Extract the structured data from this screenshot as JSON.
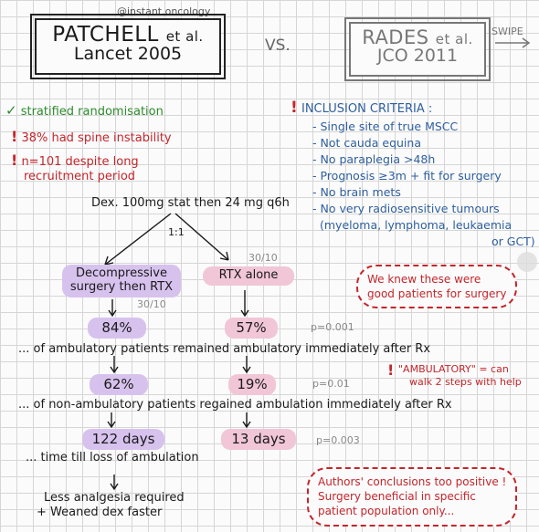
{
  "handle": "@instant.oncology",
  "swipe": "SWIPE",
  "vs": "VS.",
  "left_study": {
    "name": "PATCHELL",
    "etal": "et al.",
    "journal": "Lancet 2005"
  },
  "right_study": {
    "name": "RADES",
    "etal": "et al.",
    "journal": "JCO 2011"
  },
  "left_notes": [
    {
      "mark": "✓",
      "text": "stratified randomisation"
    },
    {
      "mark": "!",
      "text": "38% had spine instability"
    },
    {
      "mark": "!",
      "text": "n=101 despite long",
      "text2": "recruitment period"
    }
  ],
  "inclusion": {
    "mark": "!",
    "heading": "INCLUSION CRITERIA :",
    "items": [
      "- Single site of true MSCC",
      "- Not cauda equina",
      "- No paraplegia >48h",
      "- Prognosis ≥3m + fit for surgery",
      "- No brain mets",
      "- No very radiosensitive tumours",
      "(myeloma, lymphoma, leukaemia",
      "or GCT)"
    ]
  },
  "cloud1": {
    "line1": "We knew these were",
    "line2": "good patients for surgery"
  },
  "dex": "Dex. 100mg stat then 24 mg q6h",
  "ratio": "1:1",
  "arm_surgery": {
    "line1": "Decompressive",
    "line2": "surgery then RTX",
    "dose": "30/10"
  },
  "arm_rtx": {
    "label": "RTX alone",
    "dose": "30/10"
  },
  "row1": {
    "left": "84%",
    "right": "57%",
    "p": "p=0.001",
    "caption": "... of ambulatory patients remained ambulatory immediately after Rx"
  },
  "row2": {
    "left": "62%",
    "right": "19%",
    "p": "p=0.01",
    "caption": "... of non-ambulatory patients regained ambulation immediately after Rx"
  },
  "row3": {
    "left": "122 days",
    "right": "13 days",
    "p": "p=0.003",
    "caption": "... time till loss of ambulation"
  },
  "ambulatory_note": {
    "mark": "!",
    "line1": "\"AMBULATORY\" = can",
    "line2": "walk 2 steps with help"
  },
  "bottom": {
    "line1": "Less analgesia required",
    "line2": "+ Weaned dex faster"
  },
  "cloud2": {
    "line1": "Authors' conclusions too positive !",
    "line2": "Surgery beneficial in specific",
    "line3": "patient population only..."
  },
  "colors": {
    "green": "#2d8a2d",
    "red": "#c4252b",
    "blue": "#2f5f9e",
    "purple": "#d7c2ee",
    "pink": "#f1c6d6"
  }
}
